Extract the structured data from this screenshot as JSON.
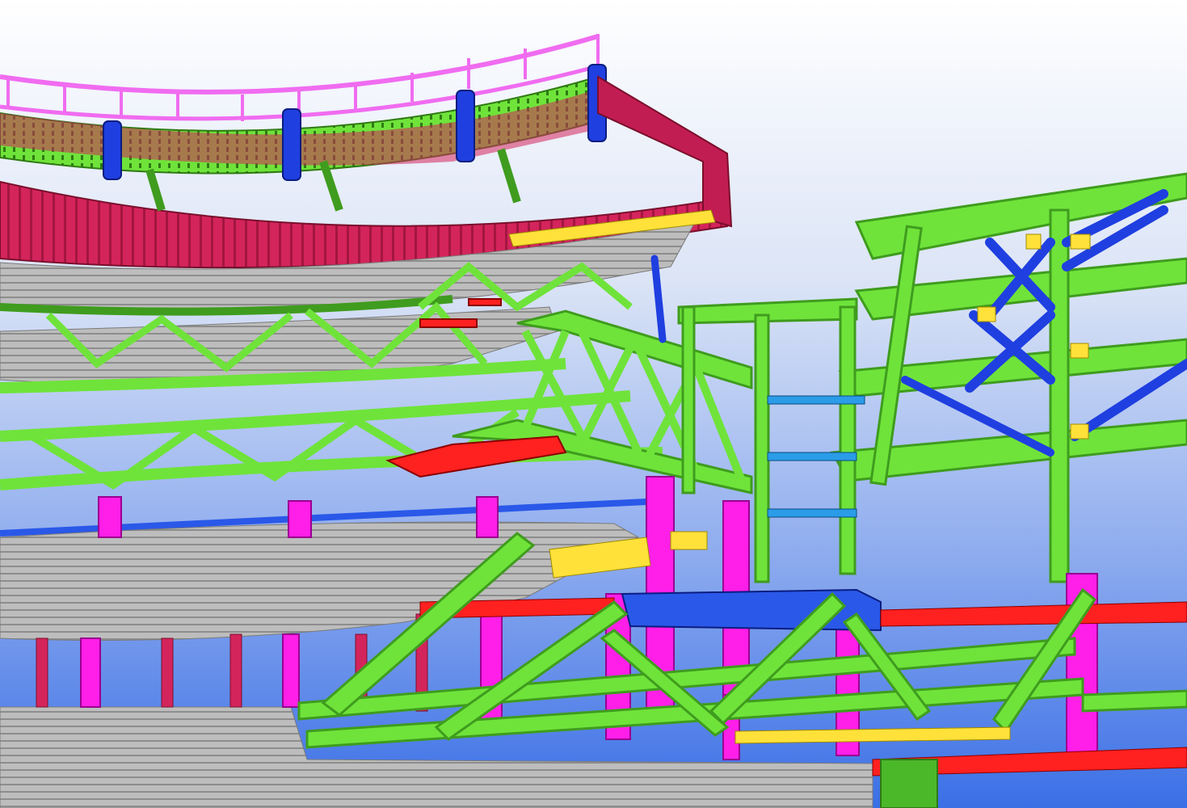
{
  "scene": {
    "kind": "3d-structural-steel-model-render",
    "colors": {
      "sky_top": "#ffffff",
      "sky_mid": "#c8d6f0",
      "sky_bottom": "#3a6fe6",
      "beam_green": "#6fe33a",
      "beam_green_dark": "#3f9c1e",
      "column_magenta": "#ff1fe8",
      "railing_red": "#d4245c",
      "railing_pink": "#f06cf0",
      "brace_blue": "#1f3fe0",
      "plate_yellow": "#ffe13a",
      "tread_grey": "#b9b9b9",
      "tread_grey_dark": "#8d8d8d",
      "accent_red": "#ff2020",
      "deck_blue": "#2a58e8"
    }
  }
}
